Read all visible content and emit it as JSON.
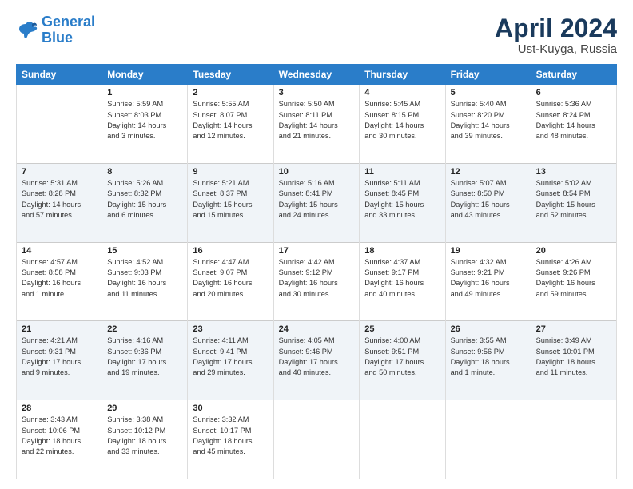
{
  "header": {
    "logo_line1": "General",
    "logo_line2": "Blue",
    "month": "April 2024",
    "location": "Ust-Kuyga, Russia"
  },
  "days_of_week": [
    "Sunday",
    "Monday",
    "Tuesday",
    "Wednesday",
    "Thursday",
    "Friday",
    "Saturday"
  ],
  "weeks": [
    [
      {
        "day": "",
        "info": ""
      },
      {
        "day": "1",
        "info": "Sunrise: 5:59 AM\nSunset: 8:03 PM\nDaylight: 14 hours\nand 3 minutes."
      },
      {
        "day": "2",
        "info": "Sunrise: 5:55 AM\nSunset: 8:07 PM\nDaylight: 14 hours\nand 12 minutes."
      },
      {
        "day": "3",
        "info": "Sunrise: 5:50 AM\nSunset: 8:11 PM\nDaylight: 14 hours\nand 21 minutes."
      },
      {
        "day": "4",
        "info": "Sunrise: 5:45 AM\nSunset: 8:15 PM\nDaylight: 14 hours\nand 30 minutes."
      },
      {
        "day": "5",
        "info": "Sunrise: 5:40 AM\nSunset: 8:20 PM\nDaylight: 14 hours\nand 39 minutes."
      },
      {
        "day": "6",
        "info": "Sunrise: 5:36 AM\nSunset: 8:24 PM\nDaylight: 14 hours\nand 48 minutes."
      }
    ],
    [
      {
        "day": "7",
        "info": "Sunrise: 5:31 AM\nSunset: 8:28 PM\nDaylight: 14 hours\nand 57 minutes."
      },
      {
        "day": "8",
        "info": "Sunrise: 5:26 AM\nSunset: 8:32 PM\nDaylight: 15 hours\nand 6 minutes."
      },
      {
        "day": "9",
        "info": "Sunrise: 5:21 AM\nSunset: 8:37 PM\nDaylight: 15 hours\nand 15 minutes."
      },
      {
        "day": "10",
        "info": "Sunrise: 5:16 AM\nSunset: 8:41 PM\nDaylight: 15 hours\nand 24 minutes."
      },
      {
        "day": "11",
        "info": "Sunrise: 5:11 AM\nSunset: 8:45 PM\nDaylight: 15 hours\nand 33 minutes."
      },
      {
        "day": "12",
        "info": "Sunrise: 5:07 AM\nSunset: 8:50 PM\nDaylight: 15 hours\nand 43 minutes."
      },
      {
        "day": "13",
        "info": "Sunrise: 5:02 AM\nSunset: 8:54 PM\nDaylight: 15 hours\nand 52 minutes."
      }
    ],
    [
      {
        "day": "14",
        "info": "Sunrise: 4:57 AM\nSunset: 8:58 PM\nDaylight: 16 hours\nand 1 minute."
      },
      {
        "day": "15",
        "info": "Sunrise: 4:52 AM\nSunset: 9:03 PM\nDaylight: 16 hours\nand 11 minutes."
      },
      {
        "day": "16",
        "info": "Sunrise: 4:47 AM\nSunset: 9:07 PM\nDaylight: 16 hours\nand 20 minutes."
      },
      {
        "day": "17",
        "info": "Sunrise: 4:42 AM\nSunset: 9:12 PM\nDaylight: 16 hours\nand 30 minutes."
      },
      {
        "day": "18",
        "info": "Sunrise: 4:37 AM\nSunset: 9:17 PM\nDaylight: 16 hours\nand 40 minutes."
      },
      {
        "day": "19",
        "info": "Sunrise: 4:32 AM\nSunset: 9:21 PM\nDaylight: 16 hours\nand 49 minutes."
      },
      {
        "day": "20",
        "info": "Sunrise: 4:26 AM\nSunset: 9:26 PM\nDaylight: 16 hours\nand 59 minutes."
      }
    ],
    [
      {
        "day": "21",
        "info": "Sunrise: 4:21 AM\nSunset: 9:31 PM\nDaylight: 17 hours\nand 9 minutes."
      },
      {
        "day": "22",
        "info": "Sunrise: 4:16 AM\nSunset: 9:36 PM\nDaylight: 17 hours\nand 19 minutes."
      },
      {
        "day": "23",
        "info": "Sunrise: 4:11 AM\nSunset: 9:41 PM\nDaylight: 17 hours\nand 29 minutes."
      },
      {
        "day": "24",
        "info": "Sunrise: 4:05 AM\nSunset: 9:46 PM\nDaylight: 17 hours\nand 40 minutes."
      },
      {
        "day": "25",
        "info": "Sunrise: 4:00 AM\nSunset: 9:51 PM\nDaylight: 17 hours\nand 50 minutes."
      },
      {
        "day": "26",
        "info": "Sunrise: 3:55 AM\nSunset: 9:56 PM\nDaylight: 18 hours\nand 1 minute."
      },
      {
        "day": "27",
        "info": "Sunrise: 3:49 AM\nSunset: 10:01 PM\nDaylight: 18 hours\nand 11 minutes."
      }
    ],
    [
      {
        "day": "28",
        "info": "Sunrise: 3:43 AM\nSunset: 10:06 PM\nDaylight: 18 hours\nand 22 minutes."
      },
      {
        "day": "29",
        "info": "Sunrise: 3:38 AM\nSunset: 10:12 PM\nDaylight: 18 hours\nand 33 minutes."
      },
      {
        "day": "30",
        "info": "Sunrise: 3:32 AM\nSunset: 10:17 PM\nDaylight: 18 hours\nand 45 minutes."
      },
      {
        "day": "",
        "info": ""
      },
      {
        "day": "",
        "info": ""
      },
      {
        "day": "",
        "info": ""
      },
      {
        "day": "",
        "info": ""
      }
    ]
  ]
}
